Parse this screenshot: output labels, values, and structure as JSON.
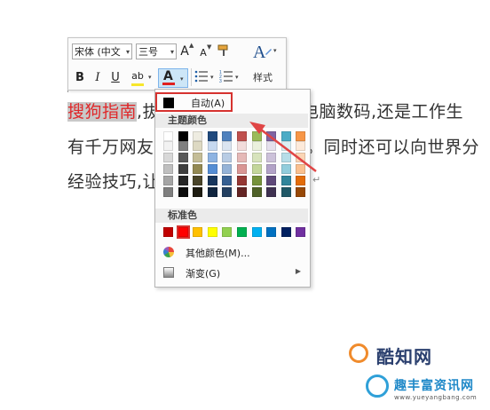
{
  "document": {
    "line1_selected": "搜狗指南",
    "line1_visible_start": ",拔",
    "line1_visible_end": "电脑数码,还是工作生",
    "line2_start": "有千万网友",
    "line2_end": "。同时还可以向世界分",
    "line3_start": "经验技巧,让",
    "para_mark": "↵"
  },
  "mini_toolbar": {
    "font_name": "宋体 (中文",
    "font_size": "三号",
    "grow_font": "A",
    "shrink_font": "A",
    "bold": "B",
    "italic": "I",
    "underline": "U",
    "highlight": "ab",
    "font_color": "A",
    "styles_label": "样式",
    "colors": {
      "font_color_bar": "#e02020",
      "highlight_bar": "#f7e62b"
    }
  },
  "color_menu": {
    "automatic_label": "自动(A)",
    "theme_heading": "主题颜色",
    "standard_heading": "标准色",
    "more_colors": "其他颜色(M)...",
    "gradient": "渐变(G)",
    "theme_colors": [
      [
        "#ffffff",
        "#000000",
        "#eeece1",
        "#1f497d",
        "#4f81bd",
        "#c0504d",
        "#9bbb59",
        "#8064a2",
        "#4bacc6",
        "#f79646"
      ],
      [
        "#f2f2f2",
        "#7f7f7f",
        "#ddd9c3",
        "#c6d9f0",
        "#dbe5f1",
        "#f2dcdb",
        "#ebf1dd",
        "#e5e0ec",
        "#dbeef3",
        "#fdeada"
      ],
      [
        "#d8d8d8",
        "#595959",
        "#c4bd97",
        "#8db3e2",
        "#b8cce4",
        "#e5b9b7",
        "#d7e3bc",
        "#ccc1d9",
        "#b7dde8",
        "#fbd5b5"
      ],
      [
        "#bfbfbf",
        "#3f3f3f",
        "#938953",
        "#548dd4",
        "#95b3d7",
        "#d99694",
        "#c3d69b",
        "#b2a2c7",
        "#92cddc",
        "#fac08f"
      ],
      [
        "#a5a5a5",
        "#262626",
        "#494429",
        "#17365d",
        "#366092",
        "#953734",
        "#76923c",
        "#5f497a",
        "#31859b",
        "#e36c09"
      ],
      [
        "#7f7f7f",
        "#0c0c0c",
        "#1d1b10",
        "#0f243e",
        "#244061",
        "#632423",
        "#4f6128",
        "#3f3151",
        "#205867",
        "#974806"
      ]
    ],
    "standard_colors": [
      "#c00000",
      "#ff0000",
      "#ffc000",
      "#ffff00",
      "#92d050",
      "#00b050",
      "#00b0f0",
      "#0070c0",
      "#002060",
      "#7030a0"
    ]
  },
  "watermark": {
    "site_name": "酷知网",
    "brand": "趣丰富资讯网",
    "url": "www.yueyangbang.com"
  }
}
